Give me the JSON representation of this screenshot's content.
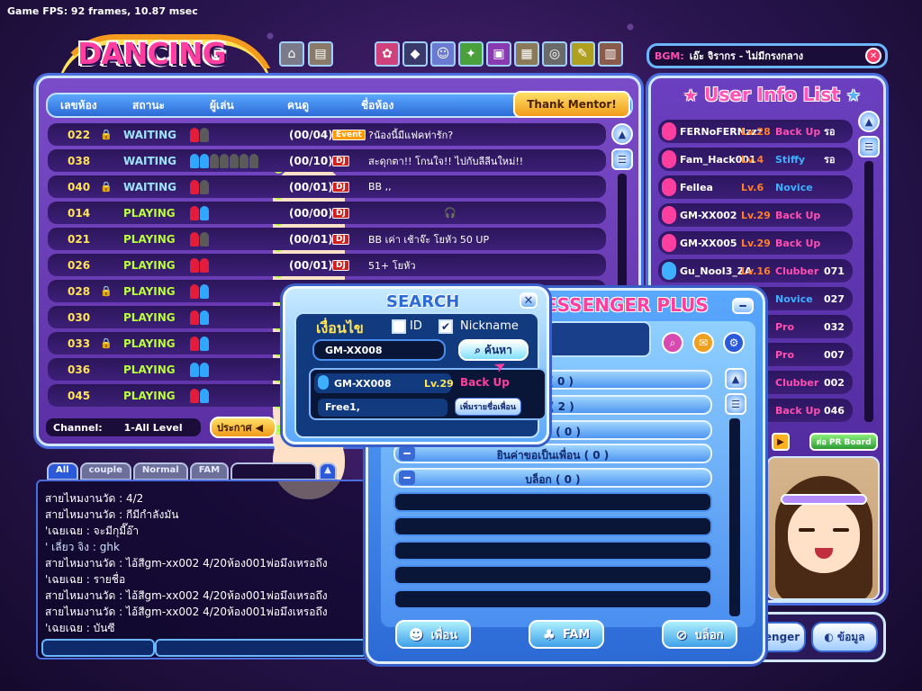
{
  "fps": "Game FPS: 92 frames, 10.87 msec",
  "logo": "DANCING HALL",
  "bgm": {
    "label": "BGM:",
    "song": "เอ๊ะ จิรากร - ไม่มีกรงกลาง"
  },
  "room_panel": {
    "headers": [
      "เลขห้อง",
      "สถานะ",
      "ผู้เล่น",
      "คนดู",
      "ชื่อห้อง"
    ],
    "mentor_button": "Thank Mentor!",
    "channel_label": "Channel:",
    "channel_value": "1-All Level",
    "announce_button": "ประกาศ",
    "rooms": [
      {
        "num": "022",
        "lock": true,
        "status": "WAITING",
        "count": "(00/04)",
        "tag": "Event",
        "name": "?น้องนี้มีแฟคท่ารัก?"
      },
      {
        "num": "038",
        "lock": false,
        "status": "WAITING",
        "count": "(00/10)",
        "tag": "DJ",
        "name": "สะดุกตา!! โกนใจ!! ไปกับลีลีนใหม่!!"
      },
      {
        "num": "040",
        "lock": true,
        "status": "WAITING",
        "count": "(00/01)",
        "tag": "DJ",
        "name": "BB ,,"
      },
      {
        "num": "014",
        "lock": false,
        "status": "PLAYING",
        "count": "(00/00)",
        "tag": "DJ",
        "name": ""
      },
      {
        "num": "021",
        "lock": false,
        "status": "PLAYING",
        "count": "(00/01)",
        "tag": "DJ",
        "name": "BB เค่า เช้าจ๊ะ โยหัว 50 UP"
      },
      {
        "num": "026",
        "lock": false,
        "status": "PLAYING",
        "count": "(00/01)",
        "tag": "DJ",
        "name": "51+ โยหัว"
      },
      {
        "num": "028",
        "lock": true,
        "status": "PLAYING",
        "count": "(",
        "tag": "",
        "name": ""
      },
      {
        "num": "030",
        "lock": false,
        "status": "PLAYING",
        "count": "",
        "tag": "",
        "name": ""
      },
      {
        "num": "033",
        "lock": true,
        "status": "PLAYING",
        "count": "",
        "tag": "",
        "name": ""
      },
      {
        "num": "036",
        "lock": false,
        "status": "PLAYING",
        "count": "",
        "tag": "",
        "name": ""
      },
      {
        "num": "045",
        "lock": false,
        "status": "PLAYING",
        "count": "",
        "tag": "",
        "name": ""
      }
    ]
  },
  "chat": {
    "tabs": [
      "All",
      "couple",
      "Normal",
      "FAM"
    ],
    "lines": [
      "สายไหมงานวัด : 4/2",
      "สายไหมงานวัด : กีมีกำลังมัน",
      "'เฉยเฉย : จะมีกุมี๊อ๊า",
      "' เลี่ยว จิง : ghk",
      "สายไหมงานวัด : ไอ้สีgm-xx002 4/20ห้อง001พ่อมึงเหรอถึง",
      "'เฉยเฉย : รายชื่อ",
      "สายไหมงานวัด : ไอ้สีgm-xx002 4/20ห้อง001พ่อมึงเหรอถึง",
      "สายไหมงานวัด : ไอ้สีgm-xx002 4/20ห้อง001พ่อมึงเหรอถึง",
      "'เฉยเฉย : บันซี"
    ]
  },
  "user_panel": {
    "title": "User Info List",
    "users": [
      {
        "name": "FERNoFERNzzz",
        "lv": "Lv.28",
        "rank": "Back Up",
        "room": "รอ",
        "gender": "f"
      },
      {
        "name": "Fam_Hack001",
        "lv": "Lv.4",
        "rank": "Stiffy",
        "room": "รอ",
        "gender": "f"
      },
      {
        "name": "Fellea",
        "lv": "Lv.6",
        "rank": "Novice",
        "room": "",
        "gender": "f"
      },
      {
        "name": "GM-XX002",
        "lv": "Lv.29",
        "rank": "Back Up",
        "room": "",
        "gender": "f"
      },
      {
        "name": "GM-XX005",
        "lv": "Lv.29",
        "rank": "Back Up",
        "room": "",
        "gender": "f"
      },
      {
        "name": "Gu_NooI3_ZA",
        "lv": "Lv.16",
        "rank": "Clubber",
        "room": "071",
        "gender": "m"
      },
      {
        "name": "",
        "lv": "",
        "rank": "Novice",
        "room": "027",
        "gender": "f"
      },
      {
        "name": "",
        "lv": "",
        "rank": "Pro",
        "room": "032",
        "gender": "f"
      },
      {
        "name": "",
        "lv": "",
        "rank": "Pro",
        "room": "007",
        "gender": "f"
      },
      {
        "name": "",
        "lv": "",
        "rank": "Clubber",
        "room": "002",
        "gender": "f"
      },
      {
        "name": "",
        "lv": "",
        "rank": "Back Up",
        "room": "046",
        "gender": "f"
      }
    ],
    "pr_button": "ต่อ PR Board",
    "bottom_buttons": [
      "senger",
      "ข้อมูล"
    ]
  },
  "messenger": {
    "title": "ESSENGER",
    "title_plus": "PLUS",
    "groups": [
      "นไ์ ( 0 )",
      "ลน์ ( 2 )",
      "ขอมา ( 0 )",
      "ยินค่าขอเป็นเพื่อน ( 0 )",
      "บล็อก ( 0 )"
    ],
    "buttons": [
      "เพื่อน",
      "FAM",
      "บล็อก"
    ]
  },
  "search": {
    "title": "SEARCH",
    "condition": "เงื่อนไข",
    "id_label": "ID",
    "nick_label": "Nickname",
    "input_value": "GM-XX008",
    "search_button": "ค้นหา",
    "result": {
      "name": "GM-XX008",
      "lv": "Lv.29",
      "rank": "Back Up",
      "status": "Free1,",
      "add_button": "เพิ่มรายชื่อเพื่อน"
    }
  }
}
